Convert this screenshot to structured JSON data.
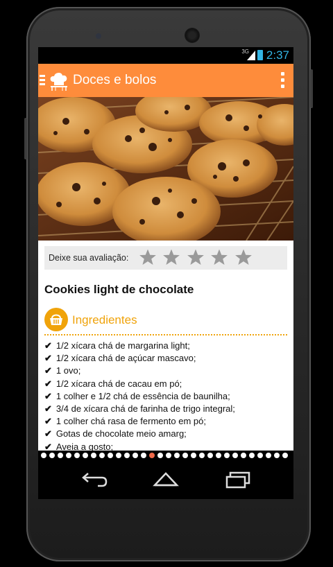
{
  "status_bar": {
    "network": "3G",
    "time": "2:37"
  },
  "app_bar": {
    "title": "Doces e bolos",
    "menu_icon": "hamburger-icon",
    "logo_icon": "chef-hat-icon",
    "overflow_icon": "overflow-menu-icon"
  },
  "hero": {
    "image": "chocolate-chip-cookies-photo"
  },
  "rating": {
    "label": "Deixe sua avaliação:",
    "max_stars": 5,
    "selected": 0
  },
  "recipe": {
    "title": "Cookies light de chocolate",
    "section_title": "Ingredientes",
    "check": "✔",
    "ingredients": [
      "1/2 xícara chá de margarina light;",
      "1/2 xícara chá de açúcar mascavo;",
      "1 ovo;",
      "1/2 xícara chá de cacau em pó;",
      "1 colher e 1/2 chá de essência de baunilha;",
      "3/4 de xícara chá de farinha de trigo integral;",
      "1 colher chá rasa de fermento em pó;",
      "Gotas de chocolate meio amarg;",
      "Aveia a gosto;"
    ]
  },
  "pager": {
    "total": 30,
    "active_index": 13
  },
  "nav_bar": {
    "back_icon": "back-icon",
    "home_icon": "home-icon",
    "recents_icon": "recents-icon"
  },
  "colors": {
    "accent": "#fe8c3b",
    "section": "#f0a30a",
    "clock": "#33b5e5",
    "active_dot": "#f06a4a"
  }
}
